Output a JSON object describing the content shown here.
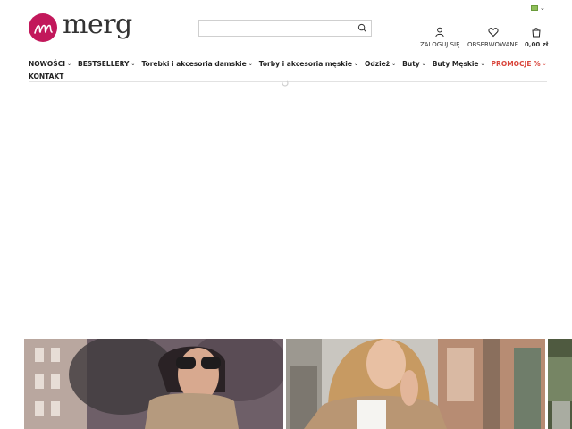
{
  "language": {
    "selector_label": ""
  },
  "brand": {
    "name": "merg",
    "logo_letter": "m",
    "color": "#c2185b"
  },
  "search": {
    "placeholder": "",
    "value": ""
  },
  "header_actions": {
    "login_label": "ZALOGUJ SIĘ",
    "wishlist_label": "OBSERWOWANE",
    "cart_label": "0,00 zł"
  },
  "nav": {
    "items": [
      {
        "label": "NOWOŚCI",
        "has_dropdown": true
      },
      {
        "label": "BESTSELLERY",
        "has_dropdown": true
      },
      {
        "label": "Torebki i akcesoria damskie",
        "has_dropdown": true
      },
      {
        "label": "Torby i akcesoria męskie",
        "has_dropdown": true
      },
      {
        "label": "Odzież",
        "has_dropdown": true
      },
      {
        "label": "Buty",
        "has_dropdown": true
      },
      {
        "label": "Buty Męskie",
        "has_dropdown": true
      },
      {
        "label": "PROMOCJE %",
        "has_dropdown": true,
        "color": "#d9463c"
      },
      {
        "label": "KONTAKT",
        "has_dropdown": false
      }
    ]
  },
  "banners": [
    {
      "icon": "woman-sunglasses-photo"
    },
    {
      "icon": "woman-blonde-blazer-photo"
    },
    {
      "icon": "partial-photo"
    }
  ]
}
